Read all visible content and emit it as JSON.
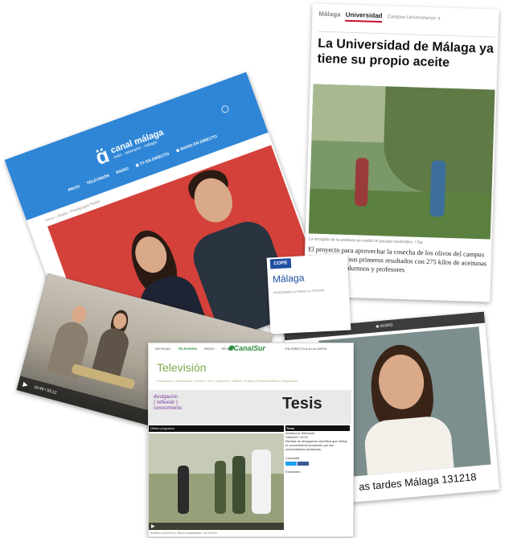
{
  "canal_malaga": {
    "logo_name": "canal málaga",
    "logo_tag": "radio · televisión · málaga",
    "nav": [
      "INICIO",
      "TELEVISIÓN",
      "RADIO",
      "◉ TV EN DIRECTO",
      "◉ RADIO EN DIRECTO"
    ],
    "breadcrumb": "Inicio › Radio › Pedagogía Radio"
  },
  "diario": {
    "brand": "Málaga",
    "section": "Universidad",
    "sub": "Campus Universitarios ∨",
    "title": "La Universidad de Málaga ya tiene su propio aceite",
    "caption": "La recogida de la aceituna se realizó el pasado noviembre. / Sur",
    "lead": "El proyecto para aprovechar la cosecha de los olivos del campus de Teatinos da sus primeros resultados con 275 kilos de aceitunas recogidas por alumnos y profesores"
  },
  "cope": {
    "logo": "COPE",
    "city": "Málaga",
    "lines": "PROGRAMAS  LA TARDE  LA LINTERNA"
  },
  "studio_video": {
    "time": "16:49 / 55:12"
  },
  "podcast": {
    "bar": "◉ AUDIO",
    "title": "as tardes Málaga 131218"
  },
  "canal_sur": {
    "nav": [
      "NOTICIAS",
      "TELEVISIÓN",
      "RADIO",
      "RTVA"
    ],
    "brand": "CanalSur",
    "right": "EN DIRECTO  ▸  A LA CARTA",
    "tv": "Televisión",
    "subnav": "Programas | Informativos | Series | Cine | Deportes | Infantil | Cultura | Entretenimiento | Especiales",
    "slogan": "divulgación\n{ reflexión }\nconocimiento",
    "banner_word": "Tesis",
    "ultimo": "Último programa",
    "side_head": "Tesis",
    "side_network": "Andalucía Televisión",
    "side_time": "SÁBADO 13:00",
    "side_text": "Revista de divulgación científica que refleja el conocimiento producido por las universidades andaluzas.",
    "compartir": "Compartir",
    "emisiones": "Emisiones",
    "footer": "Emitido 14/12/2019 | Última actualización 14/12/2019"
  }
}
